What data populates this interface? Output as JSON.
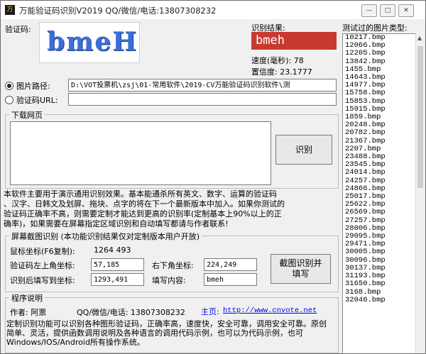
{
  "window": {
    "title": "万能验证码识别V2019    QQ/微信/电话:13807308232",
    "icon_text": "万"
  },
  "captcha": {
    "label": "验证码:",
    "image_text": "bmeH"
  },
  "result": {
    "label": "识别结果:",
    "value": "bmeh",
    "speed_label": "速度(毫秒):",
    "speed_value": "78",
    "confidence_label": "置信度:",
    "confidence_value": "23.1777"
  },
  "source": {
    "image_path_label": "图片路径:",
    "image_path_value": "D:\\VOT投票机\\zsj\\01-常用软件\\2019-CV万能验证码识别软件\\测",
    "captcha_url_label": "验证码URL:",
    "captcha_url_value": "",
    "selected": "image_path"
  },
  "download": {
    "group_title": "下载网页",
    "content": "",
    "recognize_button": "识别"
  },
  "notice": {
    "lines": [
      "本软件主要用于演示通用识别效果。基本能通杀所有英文、数字、运算的验证码",
      "、汉字、日韩文及划屏、拖块、点字的将在下一个最新版本中加入。如果你测试的",
      "验证码正确率不高，则需要定制才能达到更高的识别率(定制基本上90%以上的正",
      "确率)，如果需要在屏幕指定区域识别和自动填写都请与作者联系!"
    ]
  },
  "screen_capture": {
    "group_title": "屏幕截图识别 (本功能识别结果仅对定制版本用户开放)",
    "mouse_coord_label": "鼠标坐标(F6复制):",
    "mouse_coord_value": "1264 493",
    "top_left_label": "验证码左上角坐标:",
    "top_left_value": "57,185",
    "bottom_right_label": "右下角坐标:",
    "bottom_right_value": "224,249",
    "fill_pos_label": "识别后填写到坐标:",
    "fill_pos_value": "1293,491",
    "fill_content_label": "填写内容:",
    "fill_content_value": "bmeh",
    "capture_button_line1": "截图识别并",
    "capture_button_line2": "填写"
  },
  "program_info": {
    "group_title": "程序说明",
    "author_label": "作者: 阿票",
    "contact": "QQ/微信/电话: 13807308232",
    "homepage_label": "主页:",
    "homepage_url": "http://www.cnvote.net",
    "lines": [
      "定制识别功能可以识别各种图形验证码，正确率高，速度快，安全可靠，调用安全可靠。原创",
      "简单、灵活，提供函数调用说明及各种语言的调用代码示例，也可以为代码示例，也可",
      "Windows/IOS/Android所有操作系统。"
    ]
  },
  "file_list": {
    "title": "测试过的图片类型:",
    "items": [
      "10217.bmp",
      "12066.bmp",
      "12205.bmp",
      "13842.bmp",
      "1455.bmp",
      "14643.bmp",
      "14977.bmp",
      "15758.bmp",
      "15853.bmp",
      "15915.bmp",
      "1859.bmp",
      "20248.bmp",
      "20782.bmp",
      "21367.bmp",
      "2207.bmp",
      "23488.bmp",
      "23545.bmp",
      "24014.bmp",
      "24257.bmp",
      "24866.bmp",
      "25017.bmp",
      "25622.bmp",
      "26569.bmp",
      "27257.bmp",
      "28006.bmp",
      "29095.bmp",
      "29471.bmp",
      "30005.bmp",
      "30096.bmp",
      "30137.bmp",
      "31193.bmp",
      "31650.bmp",
      "3168.bmp",
      "32046.bmp"
    ]
  },
  "colors": {
    "result_bg": "#c83a30",
    "captcha_text": "#3a6fd8",
    "link": "#0000ee"
  }
}
